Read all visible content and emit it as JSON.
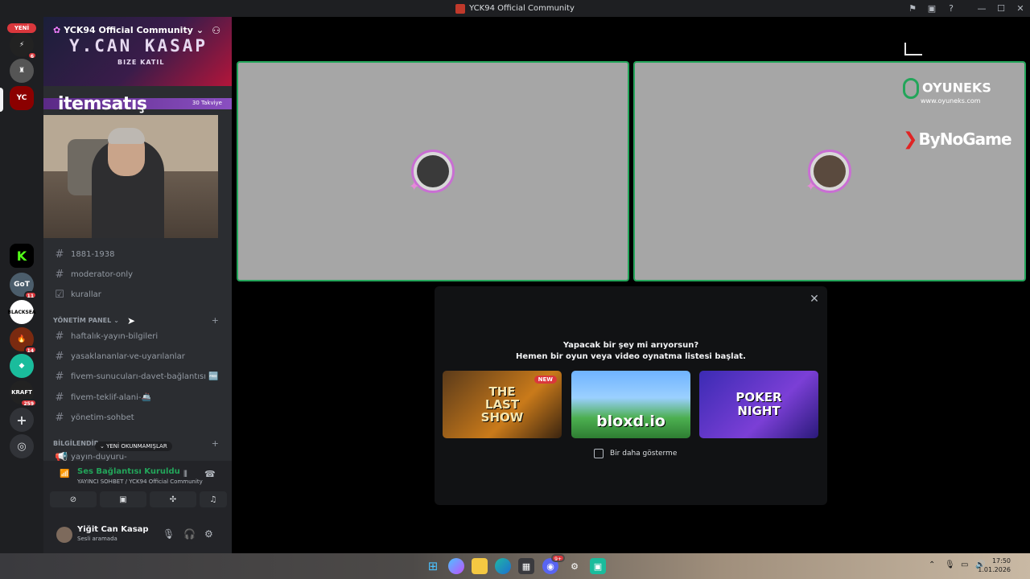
{
  "window": {
    "title": "YCK94 Official Community"
  },
  "rail": {
    "new_label": "YENİ",
    "badges": [
      "6",
      "11",
      "14",
      "259"
    ]
  },
  "guild": {
    "name": "YCK94 Official Community",
    "banner_title": "Y.CAN KASAP",
    "banner_subtitle": "BIZE KATIL",
    "boost_count": "30 Takviye",
    "sponsor": "itemsatış"
  },
  "channels": [
    {
      "name": "1881-1938",
      "icon": "hash-icon"
    },
    {
      "name": "moderator-only",
      "icon": "hash-icon"
    },
    {
      "name": "kurallar",
      "icon": "rules-icon"
    }
  ],
  "categories": {
    "yonetim": "YÖNETİM PANEL",
    "bilgilendirme": "BİLGİLENDİR"
  },
  "yonetim_channels": [
    {
      "name": "haftalık-yayın-bilgileri"
    },
    {
      "name": "yasaklananlar-ve-uyarılanlar"
    },
    {
      "name": "fivem-sunucuları-davet-bağlantısı 🆓"
    },
    {
      "name": "fivem-teklif-alani-🚢"
    },
    {
      "name": "yönetim-sohbet"
    }
  ],
  "partial_channel": "yayın-duyuru-",
  "unread_label": "YENİ OKUNMAMIŞLAR",
  "voice": {
    "status": "Ses Bağlantısı Kuruldu",
    "detail": "YAYINCI SOHBET / YCK94 Official Community"
  },
  "user": {
    "name": "Yiğit Can Kasap",
    "status": "Sesli aramada"
  },
  "stage": {
    "sponsor1": "OYUNEKS",
    "sponsor1_url": "www.oyuneks.com",
    "sponsor2": "ByNoGame"
  },
  "modal": {
    "line1": "Yapacak bir şey mi arıyorsun?",
    "line2": "Hemen bir oyun veya video oynatma listesi başlat.",
    "cards": [
      {
        "label": "THE LAST SHOW",
        "badge": "NEW"
      },
      {
        "label": "bloxd.io"
      },
      {
        "label": "POKER NIGHT"
      }
    ],
    "checkbox_label": "Bir daha gösterme"
  },
  "taskbar": {
    "time": "17:50",
    "date": "1.01.2026",
    "discord_badge": "9+"
  },
  "colors": {
    "accent_green": "#23a55a",
    "danger_red": "#da373c",
    "sidebar_bg": "#2b2d31",
    "rail_bg": "#1e1f22"
  }
}
